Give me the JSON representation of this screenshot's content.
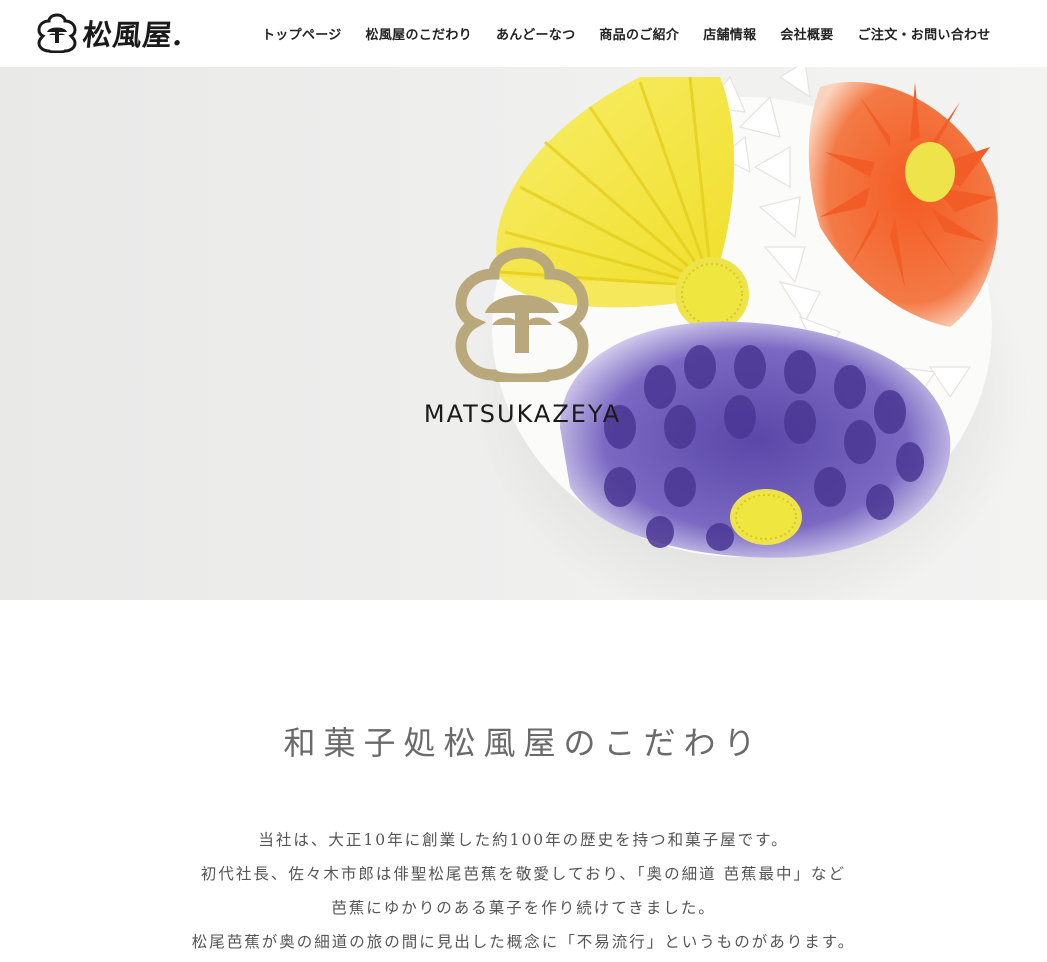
{
  "header": {
    "brand_name": "松風屋.",
    "brand_icon": "matsukazeya-crest-icon",
    "nav": [
      {
        "label": "トップページ"
      },
      {
        "label": "松風屋のこだわり"
      },
      {
        "label": "あんどーなつ"
      },
      {
        "label": "商品のご紹介"
      },
      {
        "label": "店舗情報"
      },
      {
        "label": "会社概要"
      },
      {
        "label": "ご注文・お問い合わせ"
      }
    ]
  },
  "hero": {
    "logo_text": "MATSUKAZEYA",
    "logo_icon": "matsukazeya-crest-icon",
    "colors": {
      "logo": "#b9a87b",
      "yellow": "#f5e64a",
      "orange": "#f2622e",
      "purple": "#6f5cb8",
      "center": "#eee34a"
    }
  },
  "content": {
    "title": "和菓子処松風屋のこだわり",
    "lines": [
      "当社は、大正10年に創業した約100年の歴史を持つ和菓子屋です。",
      "初代社長、佐々木市郎は俳聖松尾芭蕉を敬愛しており、「奥の細道 芭蕉最中」など",
      "芭蕉にゆかりのある菓子を作り続けてきました。",
      "松尾芭蕉が奥の細道の旅の間に見出した概念に「不易流行」というものがあります。"
    ]
  }
}
